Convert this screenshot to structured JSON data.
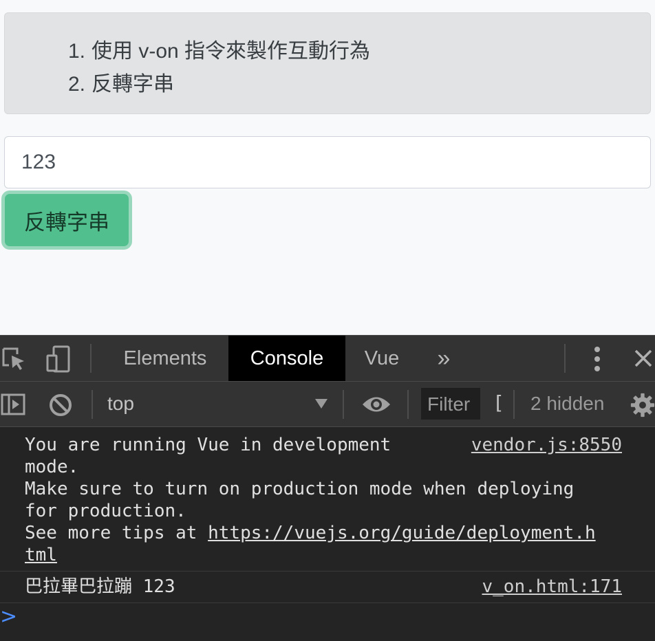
{
  "page": {
    "list_items": [
      {
        "num": "1.",
        "text": "使用 v-on 指令來製作互動行為"
      },
      {
        "num": "2.",
        "text": "反轉字串"
      }
    ],
    "input_value": "123",
    "button_label": "反轉字串"
  },
  "devtools": {
    "tabs": [
      "Elements",
      "Console",
      "Vue"
    ],
    "active_tab": "Console",
    "more_tabs_glyph": "»",
    "context": "top",
    "filter_placeholder": "Filter",
    "filter_extra": "[",
    "hidden_count": "2 hidden",
    "messages": [
      {
        "lines": [
          "You are running Vue in development",
          "mode.",
          "Make sure to turn on production mode when deploying",
          "for production.",
          "See more tips at "
        ],
        "link_lines": [
          "https://vuejs.org/guide/deployment.h",
          "tml"
        ],
        "source": "vendor.js:8550"
      },
      {
        "text": "巴拉畢巴拉蹦 123",
        "source": "v_on.html:171"
      }
    ],
    "prompt_glyph": ">"
  },
  "colors": {
    "list_bg": "#e2e3e5",
    "button_bg": "#52c08e",
    "devtools_bg": "#242424",
    "prompt": "#4c8dff"
  }
}
